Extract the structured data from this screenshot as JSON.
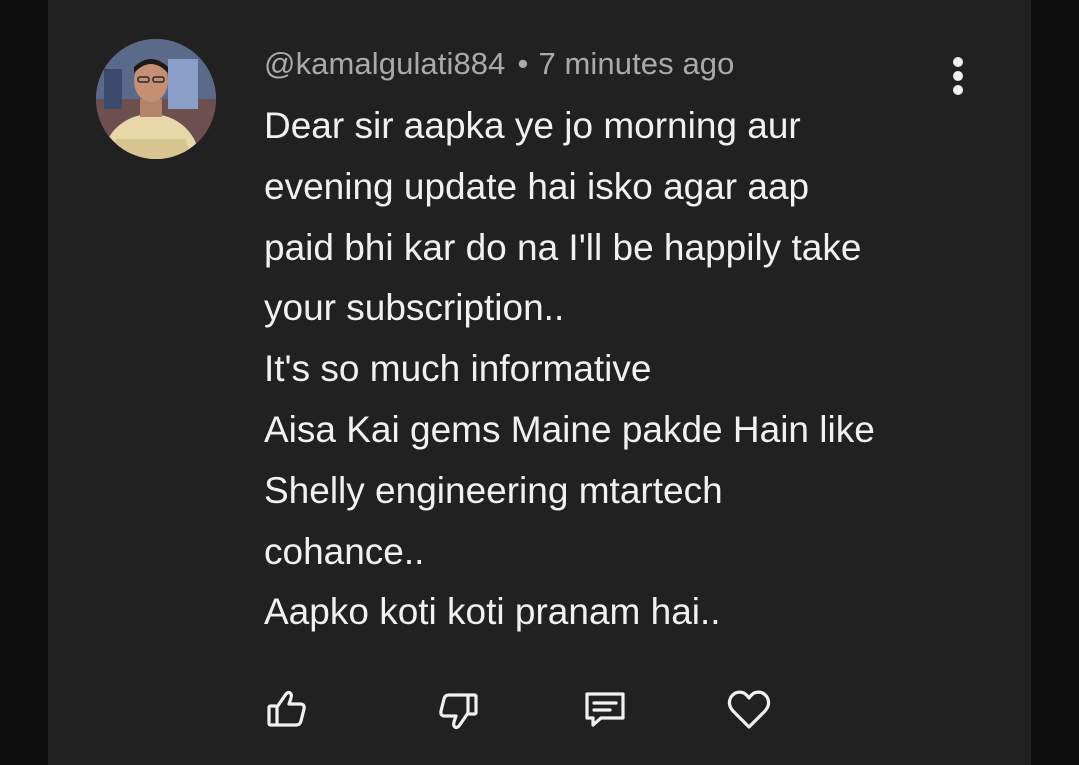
{
  "comment": {
    "username": "@kamalgulati884",
    "separator": "•",
    "timestamp": "7 minutes ago",
    "lines": [
      "Dear sir aapka ye jo morning aur",
      "evening update hai isko agar aap",
      "paid bhi kar do na I'll be happily take",
      "your subscription..",
      "It's so much informative",
      "Aisa Kai gems Maine pakde Hain like",
      "Shelly engineering mtartech",
      "cohance..",
      "Aapko koti koti pranam hai.."
    ]
  },
  "actions": {
    "like_icon": "thumbs-up-icon",
    "dislike_icon": "thumbs-down-icon",
    "reply_icon": "comment-icon",
    "heart_icon": "heart-icon",
    "more_icon": "more-vertical-icon"
  },
  "colors": {
    "background": "#0f0f0f",
    "card": "#212121",
    "text_primary": "#f1f1f1",
    "text_secondary": "#aaaaaa"
  }
}
